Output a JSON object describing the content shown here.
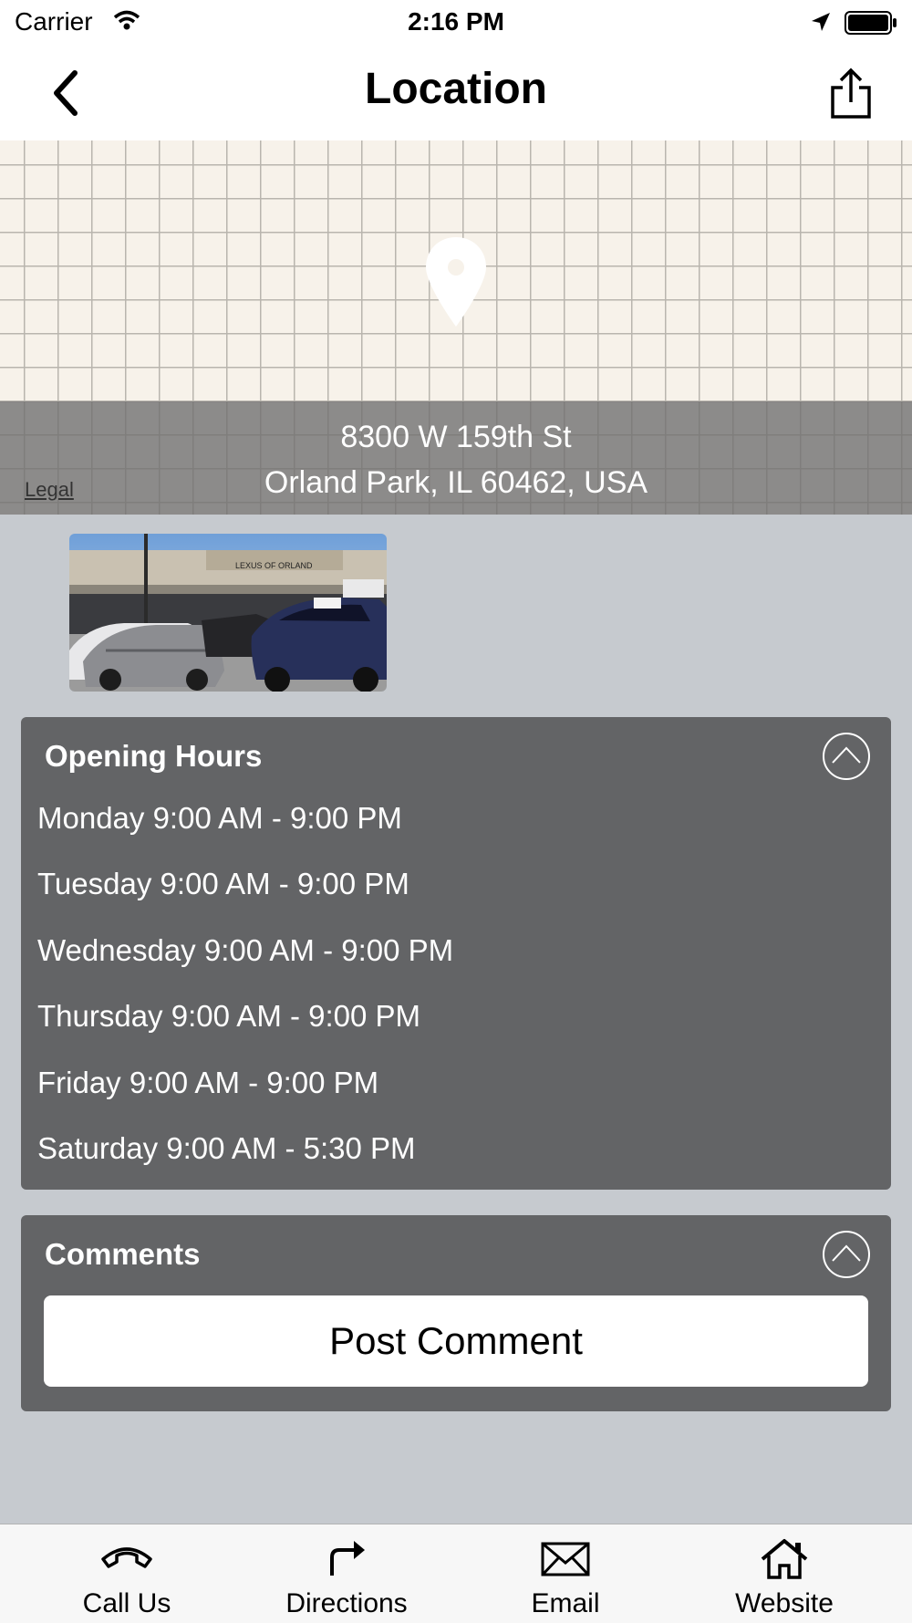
{
  "status_bar": {
    "carrier": "Carrier",
    "time": "2:16 PM"
  },
  "nav": {
    "title": "Location"
  },
  "map": {
    "address_line1": "8300 W 159th St",
    "address_line2": "Orland Park, IL 60462, USA",
    "legal_label": "Legal"
  },
  "opening_hours": {
    "title": "Opening Hours",
    "rows": [
      "Monday 9:00 AM - 9:00 PM",
      "Tuesday 9:00 AM - 9:00 PM",
      "Wednesday 9:00 AM - 9:00 PM",
      "Thursday 9:00 AM - 9:00 PM",
      "Friday 9:00 AM - 9:00 PM",
      "Saturday 9:00 AM - 5:30 PM"
    ]
  },
  "comments": {
    "title": "Comments",
    "post_button": "Post Comment"
  },
  "tabbar": {
    "items": [
      {
        "label": "Call Us",
        "icon": "phone-icon"
      },
      {
        "label": "Directions",
        "icon": "directions-icon"
      },
      {
        "label": "Email",
        "icon": "email-icon"
      },
      {
        "label": "Website",
        "icon": "home-icon"
      }
    ]
  },
  "colors": {
    "background": "#c6cacf",
    "card": "#636466",
    "map_base": "#f7f2ea",
    "address_band": "#6e6e6e"
  }
}
